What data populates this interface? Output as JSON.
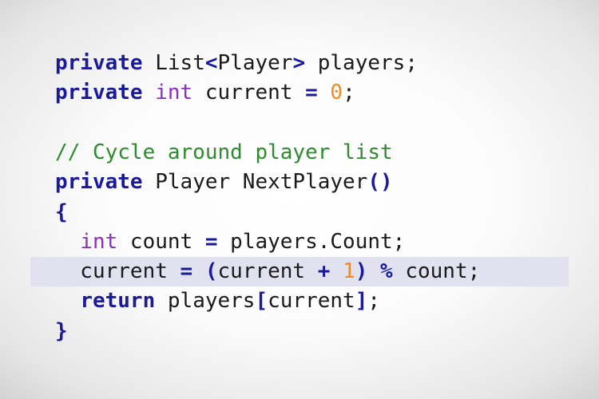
{
  "code": {
    "lines": [
      [
        {
          "text": "private",
          "kind": "keyword"
        },
        {
          "text": " List",
          "kind": "ident"
        },
        {
          "text": "<",
          "kind": "op"
        },
        {
          "text": "Player",
          "kind": "ident"
        },
        {
          "text": ">",
          "kind": "op"
        },
        {
          "text": " players;",
          "kind": "ident"
        }
      ],
      [
        {
          "text": "private",
          "kind": "keyword"
        },
        {
          "text": " ",
          "kind": "ident"
        },
        {
          "text": "int",
          "kind": "type"
        },
        {
          "text": " current ",
          "kind": "ident"
        },
        {
          "text": "=",
          "kind": "op"
        },
        {
          "text": " ",
          "kind": "ident"
        },
        {
          "text": "0",
          "kind": "number"
        },
        {
          "text": ";",
          "kind": "ident"
        }
      ],
      [],
      [
        {
          "text": "// Cycle around player list",
          "kind": "comment"
        }
      ],
      [
        {
          "text": "private",
          "kind": "keyword"
        },
        {
          "text": " Player NextPlayer",
          "kind": "ident"
        },
        {
          "text": "()",
          "kind": "op"
        }
      ],
      [
        {
          "text": "{",
          "kind": "op"
        }
      ],
      [
        {
          "text": "  ",
          "kind": "ident"
        },
        {
          "text": "int",
          "kind": "type"
        },
        {
          "text": " count ",
          "kind": "ident"
        },
        {
          "text": "=",
          "kind": "op"
        },
        {
          "text": " players.Count;",
          "kind": "ident"
        }
      ],
      [
        {
          "text": "  current ",
          "kind": "ident"
        },
        {
          "text": "=",
          "kind": "op"
        },
        {
          "text": " ",
          "kind": "ident"
        },
        {
          "text": "(",
          "kind": "op"
        },
        {
          "text": "current ",
          "kind": "ident"
        },
        {
          "text": "+",
          "kind": "op"
        },
        {
          "text": " ",
          "kind": "ident"
        },
        {
          "text": "1",
          "kind": "number"
        },
        {
          "text": ")",
          "kind": "op"
        },
        {
          "text": " ",
          "kind": "ident"
        },
        {
          "text": "%",
          "kind": "op"
        },
        {
          "text": " count;",
          "kind": "ident"
        }
      ],
      [
        {
          "text": "  ",
          "kind": "ident"
        },
        {
          "text": "return",
          "kind": "keyword"
        },
        {
          "text": " players",
          "kind": "ident"
        },
        {
          "text": "[",
          "kind": "op"
        },
        {
          "text": "current",
          "kind": "ident"
        },
        {
          "text": "]",
          "kind": "op"
        },
        {
          "text": ";",
          "kind": "ident"
        }
      ],
      [
        {
          "text": "}",
          "kind": "op"
        }
      ]
    ],
    "highlighted_line": 8
  },
  "colors": {
    "keyword": "#1a1a9a",
    "type": "#8b2fc2",
    "number": "#f08a24",
    "comment": "#2e8b2e",
    "text": "#1a1a1a",
    "highlight": "#e1e1f0"
  }
}
